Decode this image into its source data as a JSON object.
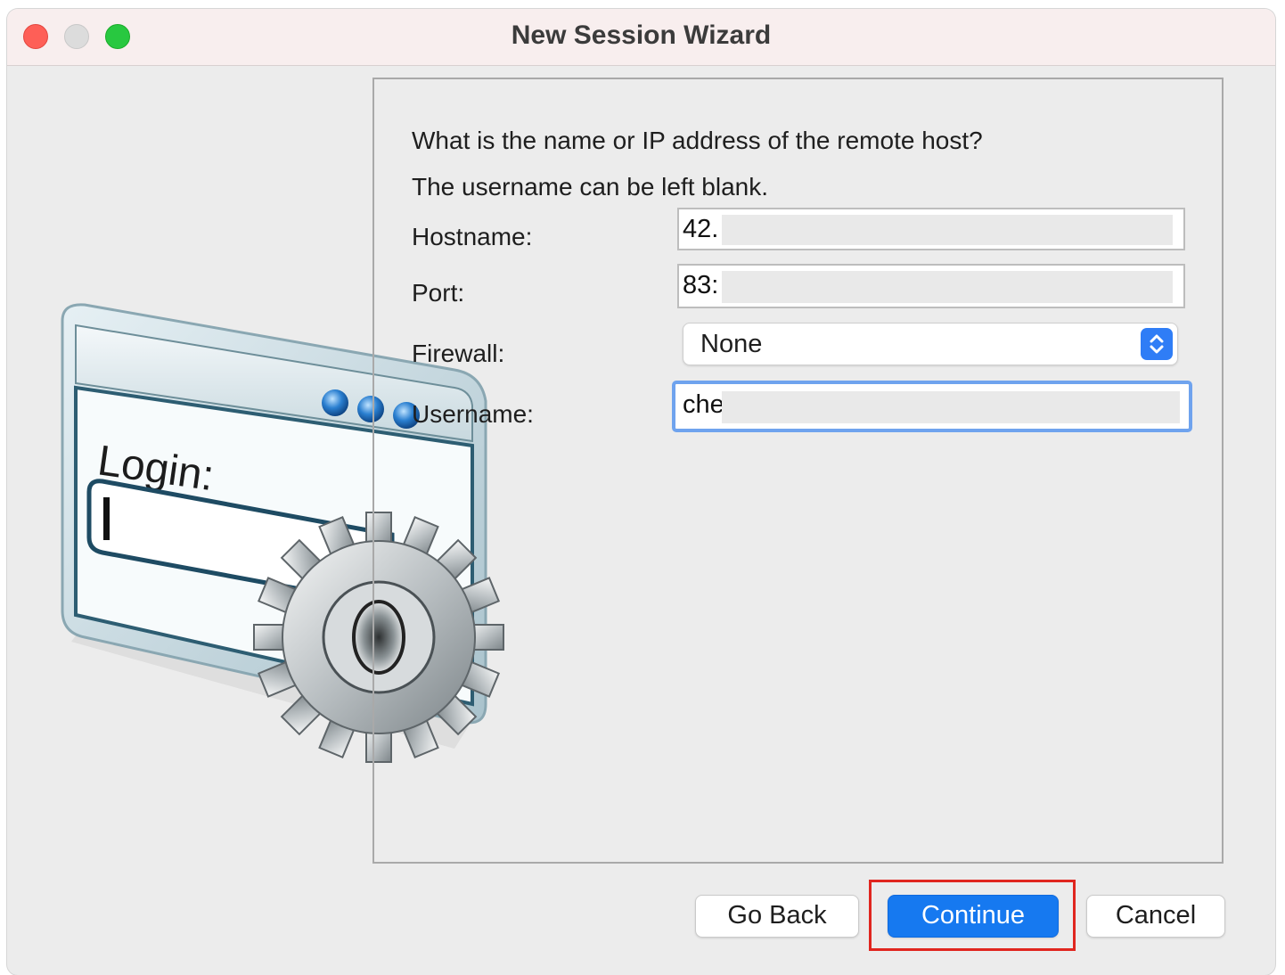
{
  "window": {
    "title": "New Session Wizard"
  },
  "illustration": {
    "login_label": "Login:"
  },
  "form": {
    "prompt_line1": "What is the name or IP address of the remote host?",
    "prompt_line2": "The username can be left blank.",
    "hostname": {
      "label": "Hostname:",
      "value": "42."
    },
    "port": {
      "label": "Port:",
      "value": "83:"
    },
    "firewall": {
      "label": "Firewall:",
      "selected": "None"
    },
    "username": {
      "label": "Username:",
      "value": "che"
    }
  },
  "buttons": {
    "go_back": "Go Back",
    "continue": "Continue",
    "cancel": "Cancel"
  },
  "colors": {
    "accent": "#1679f0",
    "highlight": "#e0261f",
    "focus_ring": "#6fa3ee"
  }
}
